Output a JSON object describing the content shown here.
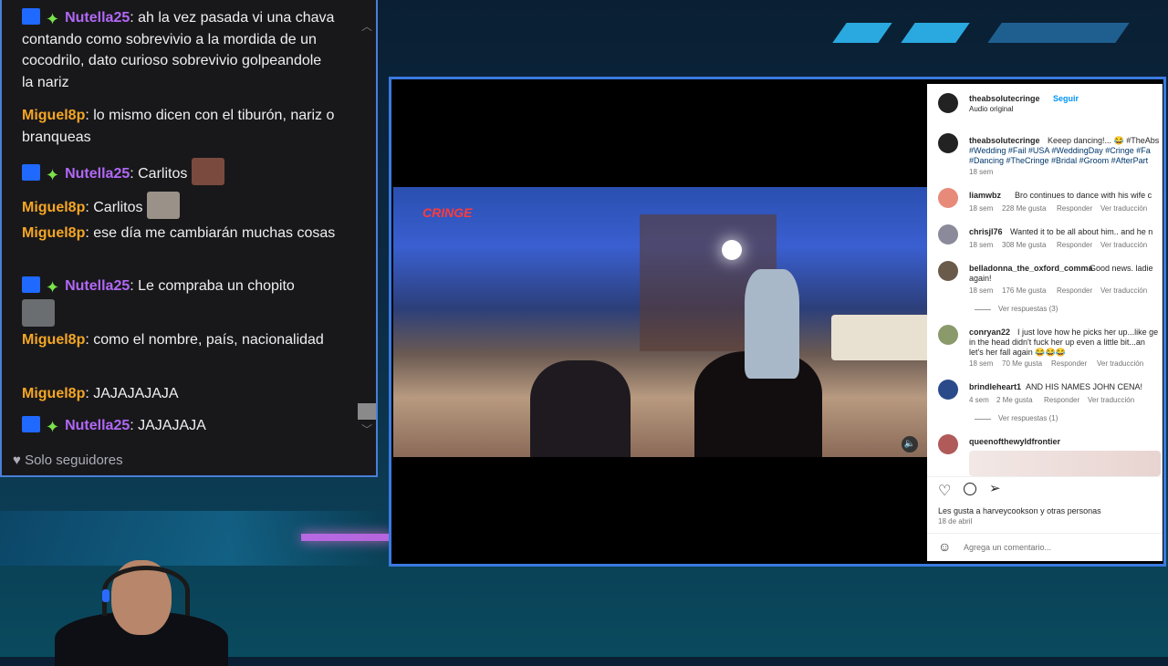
{
  "chat": {
    "messages": [
      {
        "user": "Nutella25",
        "text": ": ah la vez pasada vi una chava contando como sobrevivio a la mordida de un cocodrilo, dato curioso sobrevivio golpeandole la nariz",
        "badges": true
      },
      {
        "user": "Miguel8p",
        "text": ": lo mismo dicen con el tiburón, nariz o branqueas",
        "badges": false
      },
      {
        "user": "Nutella25",
        "text": ": Carlitos",
        "badges": true
      },
      {
        "user": "Miguel8p",
        "text": ": Carlitos",
        "badges": false
      },
      {
        "user": "Miguel8p",
        "text": ": ese día me cambiarán muchas cosas",
        "badges": false
      },
      {
        "user": "Nutella25",
        "text": ": Le compraba un chopito",
        "badges": true
      },
      {
        "user": "Miguel8p",
        "text": ": como el nombre, país, nacionalidad",
        "badges": false
      },
      {
        "user": "Miguel8p",
        "text": ": JAJAJAJAJA",
        "badges": false
      },
      {
        "user": "Nutella25",
        "text": ": JAJAJAJA",
        "badges": true
      }
    ],
    "follower_mode": "Solo seguidores"
  },
  "instagram": {
    "account": "theabsolutecringe",
    "follow": "Seguir",
    "audio": "Audio original",
    "caption_user": "theabsolutecringe",
    "caption": "Keeep dancing!... 😂 #TheAbs",
    "caption_line2": "#Wedding #Fail #USA #WeddingDay #Cringe #Fa",
    "caption_line3": "#Dancing #TheCringe #Bridal #Groom #AfterPart",
    "caption_time": "18 sem",
    "comments": [
      {
        "user": "liamwbz",
        "text": "Bro continues to dance with his wife c",
        "time": "18 sem",
        "likes": "228 Me gusta",
        "reply": "Responder",
        "translate": "Ver traducción"
      },
      {
        "user": "chrisjl76",
        "text": "Wanted it to be all about him.. and he n",
        "time": "18 sem",
        "likes": "308 Me gusta",
        "reply": "Responder",
        "translate": "Ver traducción"
      },
      {
        "user": "belladonna_the_oxford_comma",
        "text": "Good news. ladie",
        "text2": "again!",
        "time": "18 sem",
        "likes": "176 Me gusta",
        "reply": "Responder",
        "translate": "Ver traducción"
      },
      {
        "user": "conryan22",
        "text": "I just love how he picks her up...like ge",
        "text2": "in the head didn't fuck her up even a little bit...an",
        "text3": "let's her fall again 😂😂😂",
        "time": "18 sem",
        "likes": "70 Me gusta",
        "reply": "Responder",
        "translate": "Ver traducción"
      },
      {
        "user": "brindleheart1",
        "text": "AND HIS NAMES JOHN CENA!",
        "time": "4 sem",
        "likes": "2 Me gusta",
        "reply": "Responder",
        "translate": "Ver traducción"
      },
      {
        "user": "queenofthewyldfrontier",
        "text": ""
      }
    ],
    "replies_1": "Ver respuestas (3)",
    "replies_2": "Ver respuestas (1)",
    "liked_by": "Les gusta a harveycookson y otras personas",
    "date": "18 de abril",
    "add_comment": "Agrega un comentario...",
    "video_label": "CRINGE"
  },
  "colors": {
    "accent": "#3a7ae0",
    "user_orange": "#f5a623",
    "user_purple": "#b168f5"
  }
}
